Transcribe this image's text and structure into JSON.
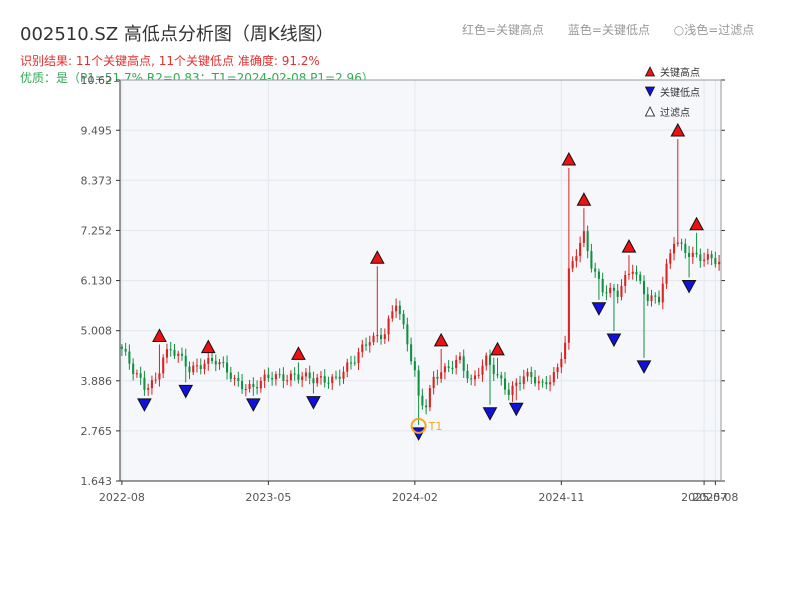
{
  "header": {
    "title": "002510.SZ 高低点分析图（周K线图）",
    "legend_red": "红色=关键高点",
    "legend_blue": "蓝色=关键低点",
    "legend_hollow": "○浅色=过滤点",
    "result_line": "识别结果: 11个关键高点, 11个关键低点   准确度: 91.2%",
    "quality_line": "优质：是（P1=51.7%  R2=0.83；T1=2024-02-08 P1=2.96）"
  },
  "colors": {
    "up": "#dd2020",
    "down": "#109040",
    "high_marker": "#ee1111",
    "low_marker": "#1111dd",
    "t1_ring": "#f5a623",
    "grid": "#e4e7ec",
    "plot_bg": "#f5f7fa",
    "axis": "#333333"
  },
  "chart_data": {
    "type": "candlestick",
    "title": "002510.SZ 高低点分析图（周K线图）",
    "x_ticks": [
      "2022-08",
      "2023-05",
      "2024-02",
      "2024-11",
      "2025-07",
      "2025-08"
    ],
    "x_tick_index": [
      0,
      39,
      78,
      117,
      155,
      158
    ],
    "y_ticks": [
      "1.643",
      "2.765",
      "3.886",
      "5.008",
      "6.130",
      "7.252",
      "8.373",
      "9.495",
      "10.62"
    ],
    "ylim": [
      1.643,
      10.62
    ],
    "n_bars": 160,
    "anchors": [
      [
        0,
        4.6
      ],
      [
        3,
        4.05
      ],
      [
        6,
        3.75
      ],
      [
        9,
        3.95
      ],
      [
        11,
        4.45
      ],
      [
        13,
        4.55
      ],
      [
        18,
        4.15
      ],
      [
        22,
        4.35
      ],
      [
        25,
        4.3
      ],
      [
        30,
        3.9
      ],
      [
        35,
        3.75
      ],
      [
        40,
        3.95
      ],
      [
        46,
        4.05
      ],
      [
        51,
        3.85
      ],
      [
        57,
        4.0
      ],
      [
        62,
        4.3
      ],
      [
        66,
        4.85
      ],
      [
        70,
        5.0
      ],
      [
        73,
        5.6
      ],
      [
        75,
        5.0
      ],
      [
        78,
        4.1
      ],
      [
        79,
        3.55
      ],
      [
        81,
        3.4
      ],
      [
        83,
        3.95
      ],
      [
        86,
        4.05
      ],
      [
        90,
        4.4
      ],
      [
        93,
        3.9
      ],
      [
        97,
        4.3
      ],
      [
        100,
        3.95
      ],
      [
        103,
        3.7
      ],
      [
        107,
        4.0
      ],
      [
        112,
        3.75
      ],
      [
        116,
        4.2
      ],
      [
        118,
        4.8
      ],
      [
        119,
        6.3
      ],
      [
        123,
        7.1
      ],
      [
        125,
        6.5
      ],
      [
        128,
        6.0
      ],
      [
        132,
        5.8
      ],
      [
        136,
        6.4
      ],
      [
        140,
        5.8
      ],
      [
        143,
        5.7
      ],
      [
        147,
        7.0
      ],
      [
        151,
        6.8
      ],
      [
        155,
        6.6
      ],
      [
        159,
        6.5
      ]
    ],
    "highs": [
      {
        "x": 10,
        "y": 4.7
      },
      {
        "x": 23,
        "y": 4.45
      },
      {
        "x": 47,
        "y": 4.3
      },
      {
        "x": 68,
        "y": 6.45
      },
      {
        "x": 85,
        "y": 4.6
      },
      {
        "x": 100,
        "y": 4.4
      },
      {
        "x": 119,
        "y": 8.65
      },
      {
        "x": 123,
        "y": 7.75
      },
      {
        "x": 135,
        "y": 6.7
      },
      {
        "x": 148,
        "y": 9.3
      },
      {
        "x": 153,
        "y": 7.2
      }
    ],
    "lows": [
      {
        "x": 6,
        "y": 3.55
      },
      {
        "x": 17,
        "y": 3.85
      },
      {
        "x": 35,
        "y": 3.55
      },
      {
        "x": 51,
        "y": 3.6
      },
      {
        "x": 79,
        "y": 2.9
      },
      {
        "x": 98,
        "y": 3.35
      },
      {
        "x": 105,
        "y": 3.45
      },
      {
        "x": 127,
        "y": 5.7
      },
      {
        "x": 131,
        "y": 5.0
      },
      {
        "x": 139,
        "y": 4.4
      },
      {
        "x": 151,
        "y": 6.2
      }
    ],
    "t1": {
      "x": 79,
      "y": 2.9,
      "label": "T1"
    },
    "legend": [
      "关键高点",
      "关键低点",
      "过滤点"
    ],
    "legend_position": "top-right"
  }
}
